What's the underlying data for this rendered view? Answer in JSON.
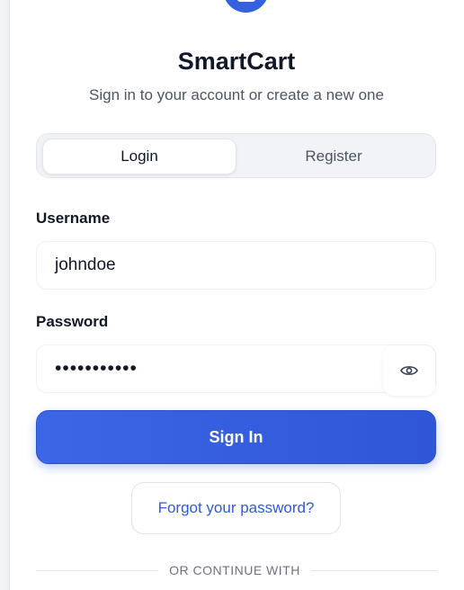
{
  "app": {
    "title": "SmartCart",
    "subtitle": "Sign in to your account or create a new one",
    "logo_icon": "receipt-icon",
    "accent_color": "#3461e0"
  },
  "tabs": [
    {
      "label": "Login",
      "active": true
    },
    {
      "label": "Register",
      "active": false
    }
  ],
  "form": {
    "username_label": "Username",
    "username_value": "johndoe",
    "password_label": "Password",
    "password_value": "•••••••••••",
    "toggle_icon": "eye-icon",
    "submit_label": "Sign In"
  },
  "forgot_label": "Forgot your password?",
  "divider_label": "OR CONTINUE WITH"
}
